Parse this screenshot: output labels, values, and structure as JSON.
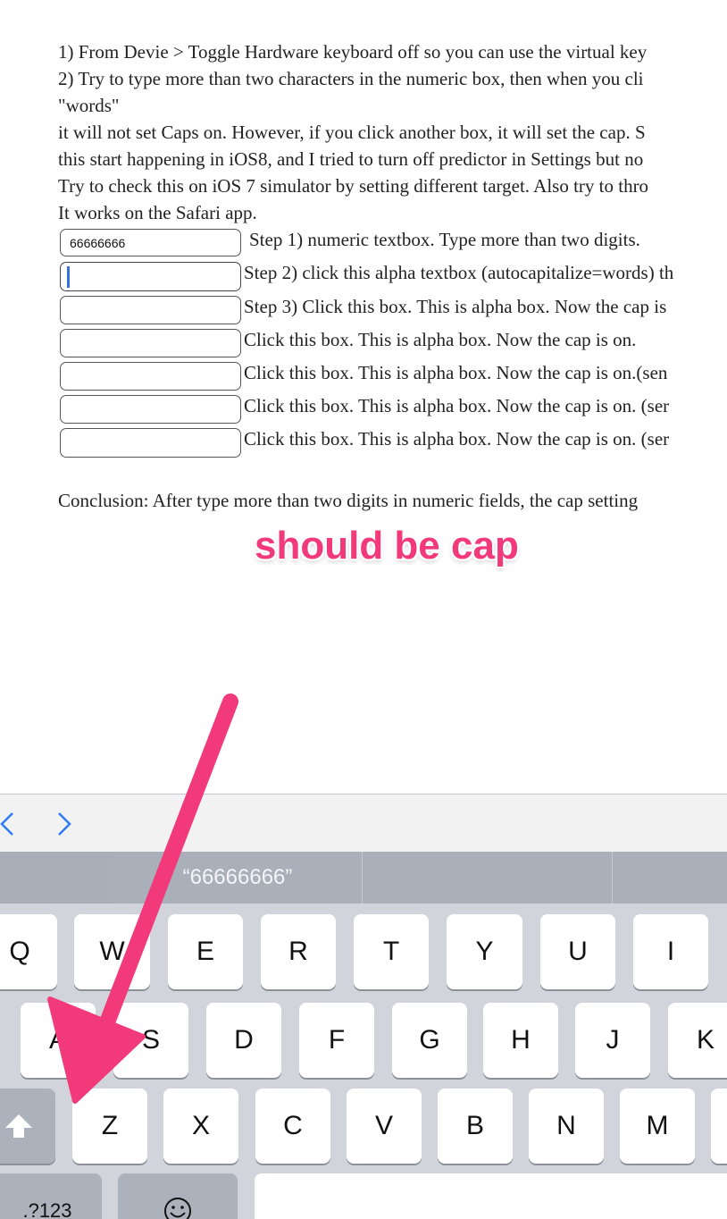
{
  "instructions": [
    "1) From Devie > Toggle Hardware keyboard off so you can use the virtual key",
    "2) Try to type more than two characters in the numeric box, then when you cli",
    "\"words\"",
    "it will not set Caps on. However, if you click another box, it will set the cap. S",
    "this start happening in iOS8, and I tried to turn off predictor in Settings but no",
    "Try to check this on iOS 7 simulator by setting different target. Also try to thro",
    "It works on the Safari app."
  ],
  "rows": [
    {
      "value": "66666666",
      "label": "Step 1) numeric textbox. Type more than two digits."
    },
    {
      "value": "",
      "label": "Step 2) click this alpha textbox (autocapitalize=words) th"
    },
    {
      "value": "",
      "label": "Step 3) Click this box. This is alpha box. Now the cap is"
    },
    {
      "value": "",
      "label": "Click this box. This is alpha box. Now the cap is on."
    },
    {
      "value": "",
      "label": "Click this box. This is alpha box. Now the cap is on.(sen"
    },
    {
      "value": "",
      "label": "Click this box. This is alpha box. Now the cap is on. (ser"
    },
    {
      "value": "",
      "label": "Click this box. This is alpha box. Now the cap is on. (ser"
    }
  ],
  "conclusion": "Conclusion: After type more than two digits in numeric fields, the cap setting",
  "annotation": "should be cap",
  "accessory": {
    "prev_icon": "chevron-left-icon",
    "next_icon": "chevron-right-icon",
    "prev": "<",
    "next": ">"
  },
  "keyboard": {
    "prediction": "“66666666”",
    "row1": [
      "Q",
      "W",
      "E",
      "R",
      "T",
      "Y",
      "U",
      "I"
    ],
    "row2": [
      "A",
      "S",
      "D",
      "F",
      "G",
      "H",
      "J",
      "K"
    ],
    "row3": [
      "Z",
      "X",
      "C",
      "V",
      "B",
      "N",
      "M"
    ],
    "shift_icon": "shift-arrow-icon",
    "numbers_label": ".?123",
    "emoji_icon": "emoji-face-icon",
    "space_label": ""
  },
  "colors": {
    "annotation": "#f23a7a",
    "arrow": "#f23a7a",
    "link_blue": "#2f7bf6",
    "cursor": "#3a6fe0"
  }
}
